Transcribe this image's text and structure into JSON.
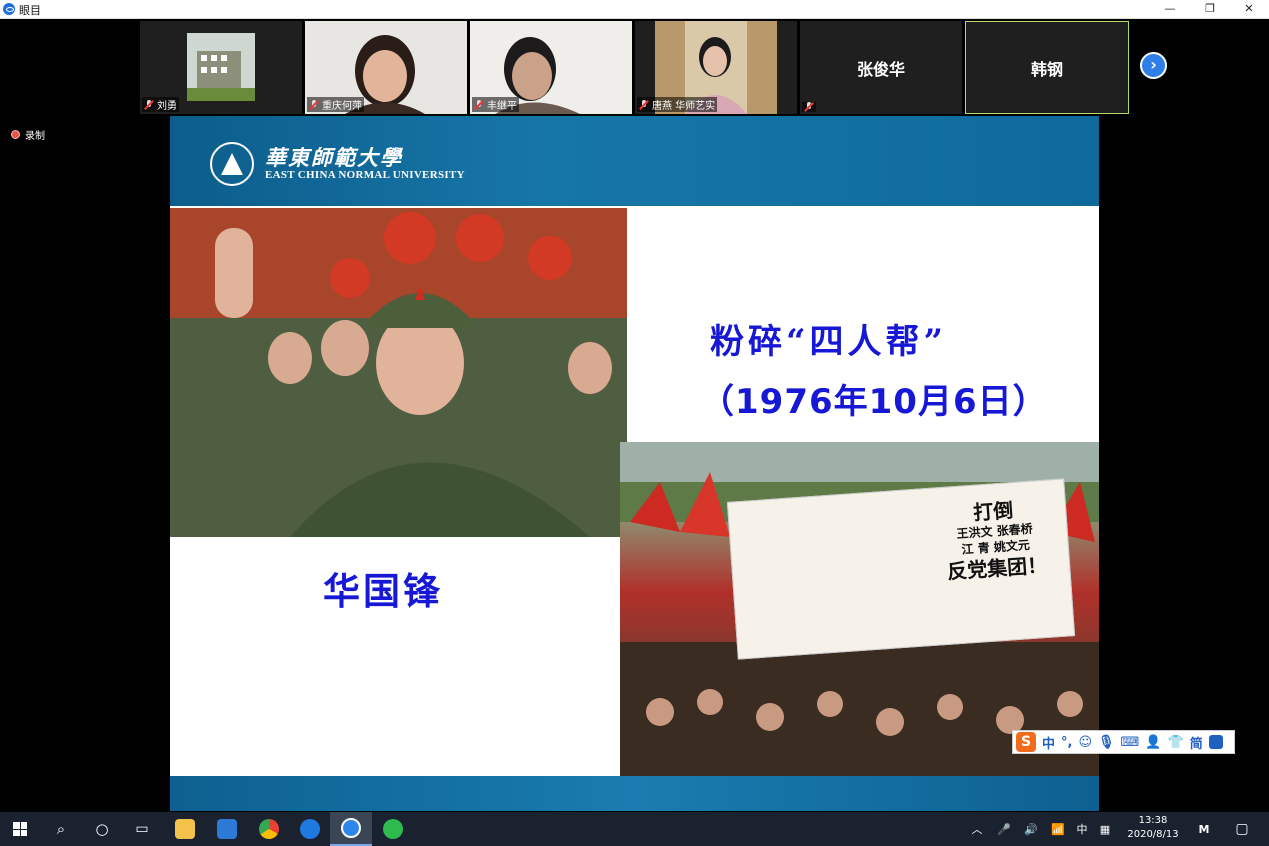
{
  "window": {
    "title": "眼目",
    "minimize": "—",
    "restore": "❐",
    "close": "✕"
  },
  "participants": [
    {
      "name": "刘勇",
      "muted": true
    },
    {
      "name": "重庆何萍",
      "muted": true
    },
    {
      "name": "丰继平",
      "muted": true
    },
    {
      "name": "唐燕 华师艺实",
      "muted": true
    },
    {
      "name": "",
      "display": "张俊华",
      "muted": true
    },
    {
      "name": "",
      "display": "韩钢",
      "active": true
    }
  ],
  "record_label": "录制",
  "slide": {
    "logo_cn": "華東師範大學",
    "logo_en": "EAST CHINA NORMAL UNIVERSITY",
    "left_caption": "华国锋",
    "title": "粉碎“四人帮”",
    "date": "（1976年10月6日）",
    "poster": {
      "line1": "打倒",
      "line2": "王洪文 张春桥",
      "line3": "江 青 姚文元",
      "line4": "反党集团！"
    }
  },
  "ime": {
    "logo": "S",
    "mode": "中",
    "punct": "°,",
    "simplified": "简"
  },
  "taskbar": {
    "tray_lang": "中",
    "time": "13:38",
    "date": "2020/8/13"
  },
  "colors": {
    "caption_blue": "#1717d6",
    "header_blue": "#0c5d8b",
    "active_border": "#b7d86b"
  }
}
